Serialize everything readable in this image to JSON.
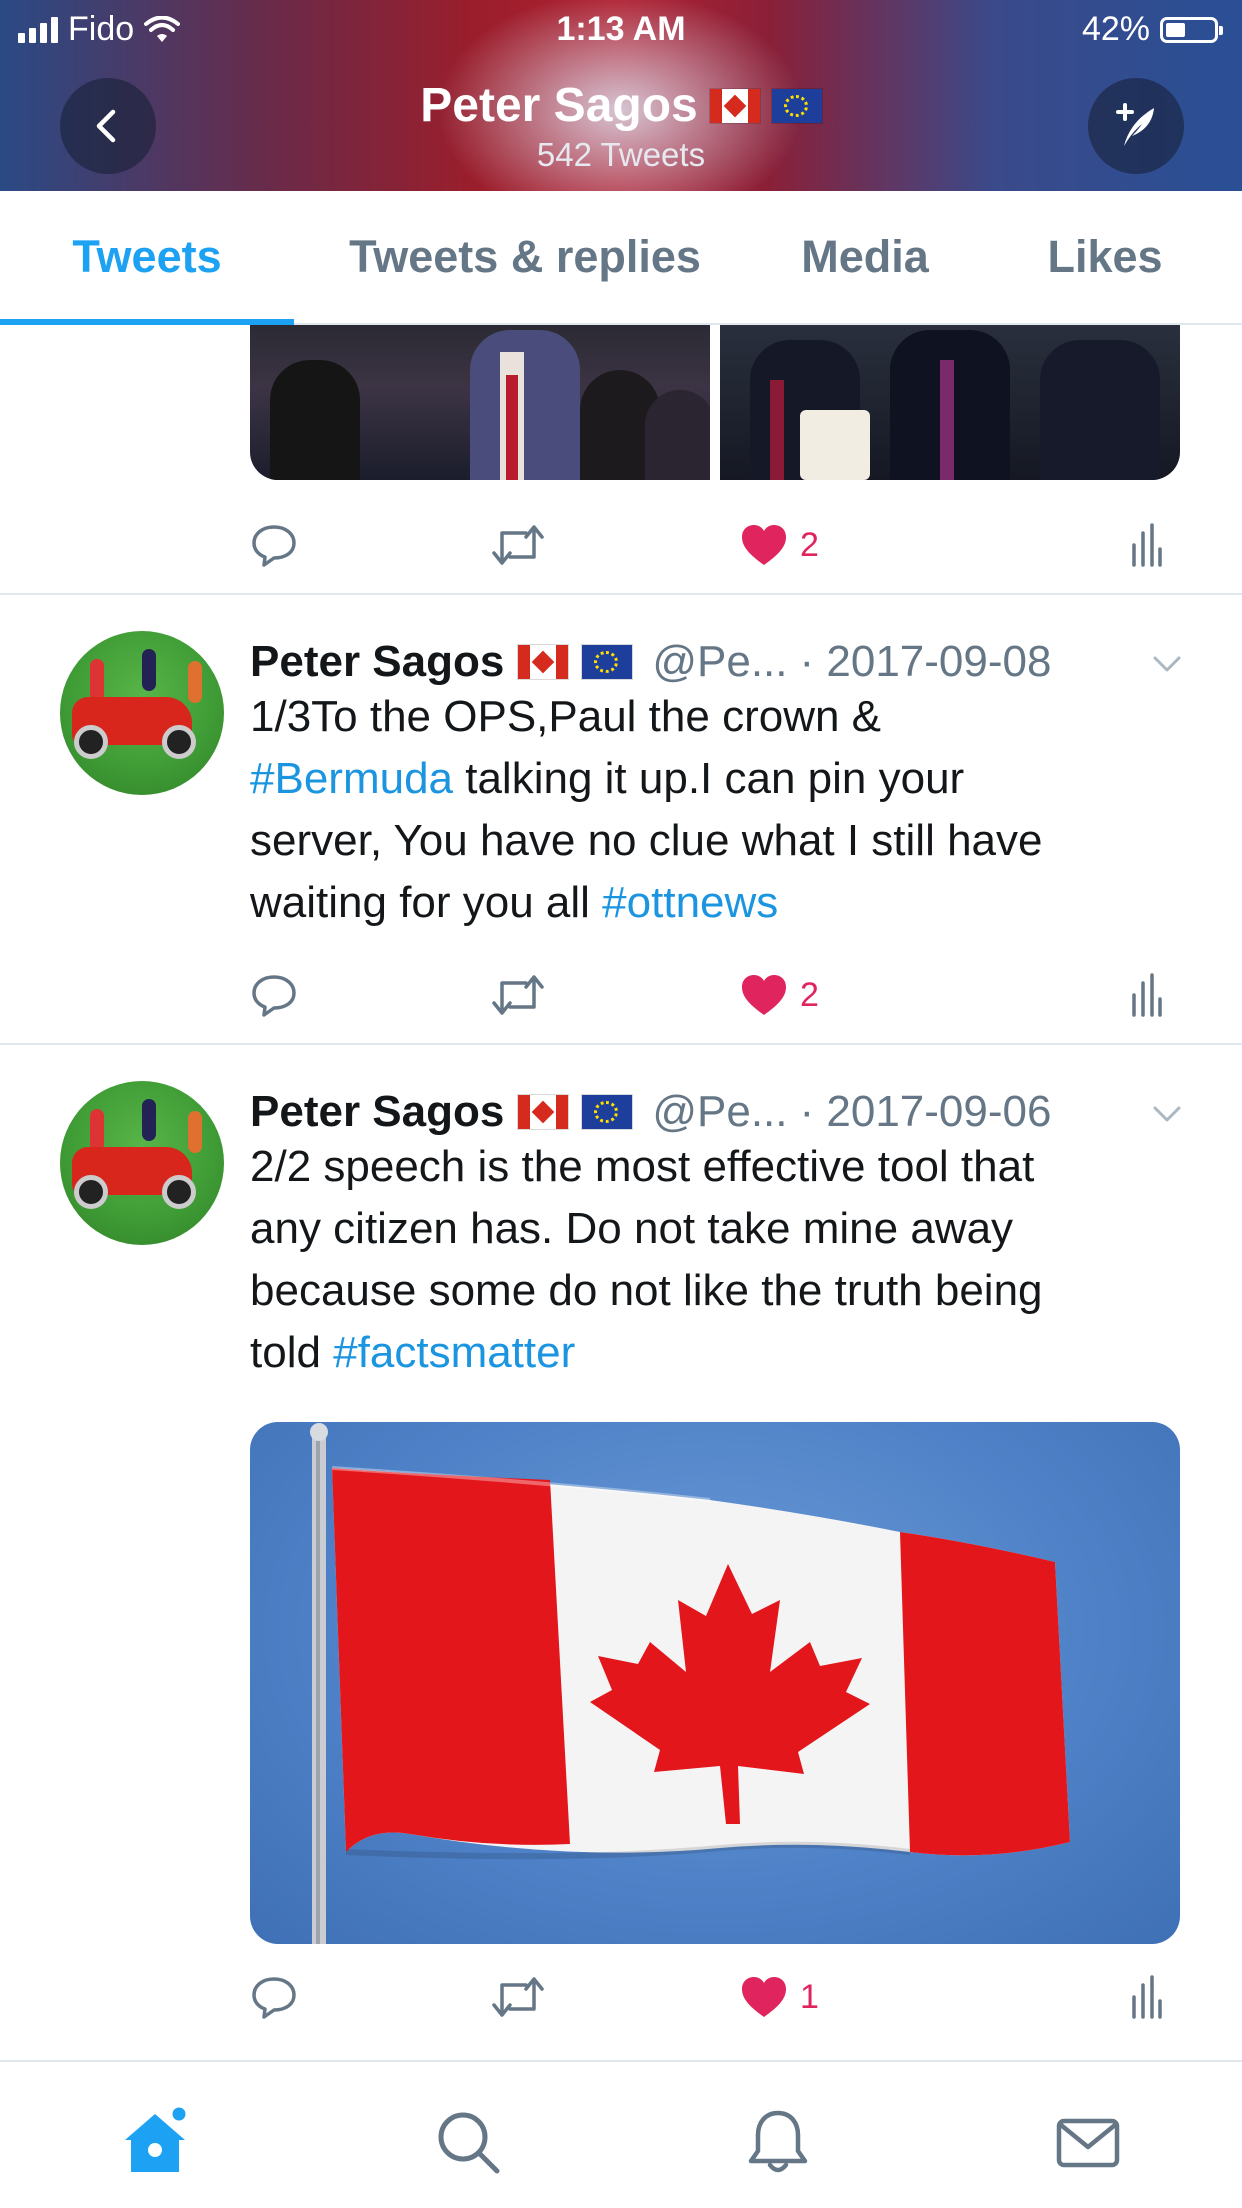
{
  "status_bar": {
    "carrier": "Fido",
    "time": "1:13 AM",
    "battery_percent": "42%",
    "battery_level": 0.42
  },
  "header": {
    "name": "Peter Sagos",
    "tweet_count": "542 Tweets",
    "back_icon": "chevron-left-icon",
    "compose_icon": "compose-tweet-icon"
  },
  "tabs": [
    {
      "label": "Tweets",
      "active": true
    },
    {
      "label": "Tweets & replies",
      "active": false
    },
    {
      "label": "Media",
      "active": false
    },
    {
      "label": "Likes",
      "active": false
    }
  ],
  "tweets": [
    {
      "media": "two-photos",
      "actions": {
        "replies": "",
        "retweets": "",
        "likes": "2"
      }
    },
    {
      "author": "Peter Sagos",
      "handle": "@Pe...",
      "date": "· 2017-09-08",
      "text_lines": [
        [
          {
            "t": "1/3To the OPS,Paul the crown &"
          }
        ],
        [
          {
            "t": "#Bermuda",
            "tag": true
          },
          {
            "t": " talking it up.I can pin your"
          }
        ],
        [
          {
            "t": "server, You have no clue what I still have"
          }
        ],
        [
          {
            "t": "waiting for you all "
          },
          {
            "t": "#ottnews",
            "tag": true
          }
        ]
      ],
      "actions": {
        "replies": "",
        "retweets": "",
        "likes": "2"
      }
    },
    {
      "author": "Peter Sagos",
      "handle": "@Pe...",
      "date": "· 2017-09-06",
      "text_lines": [
        [
          {
            "t": "2/2 speech is the most effective tool that"
          }
        ],
        [
          {
            "t": "any citizen has. Do not take mine away"
          }
        ],
        [
          {
            "t": "because some do not like the truth being"
          }
        ],
        [
          {
            "t": "told "
          },
          {
            "t": "#factsmatter",
            "tag": true
          }
        ]
      ],
      "media": "canadian-flag-photo",
      "actions": {
        "replies": "",
        "retweets": "",
        "likes": "1"
      }
    }
  ],
  "bottom_nav": [
    "home-icon",
    "search-icon",
    "notifications-bell-icon",
    "messages-envelope-icon"
  ],
  "colors": {
    "accent": "#1da1f2",
    "hashtag": "#1b95e0",
    "like": "#e0245e",
    "secondary_text": "#657786",
    "divider": "#e1e8ed"
  }
}
